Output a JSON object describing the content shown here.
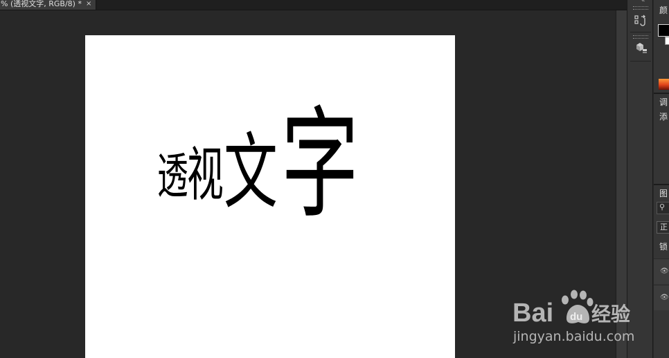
{
  "document": {
    "tab_title": "% (透视文字, RGB/8) *",
    "close_glyph": "×"
  },
  "canvas": {
    "art_text": [
      "透",
      "视",
      "文",
      "字"
    ]
  },
  "dock": {
    "collapse_glyph": "«",
    "icons": [
      "history-icon",
      "3d-properties-icon"
    ]
  },
  "right_panel": {
    "color_header": "颜",
    "adjust_header": "调",
    "add_text": "添",
    "layers_header": "图",
    "search_icon_glyph": "⚲",
    "blend_mode": "正",
    "lock_label": "锁",
    "eye_glyph": "👁"
  },
  "watermark": {
    "brand": "Bai",
    "brand_suffix": "du",
    "product": "经验",
    "url": "jingyan.baidu.com"
  },
  "colors": {
    "workspace": "#282828",
    "panel": "#353535",
    "canvas": "#ffffff",
    "text": "#000000",
    "watermark": "#b9b9b9"
  }
}
